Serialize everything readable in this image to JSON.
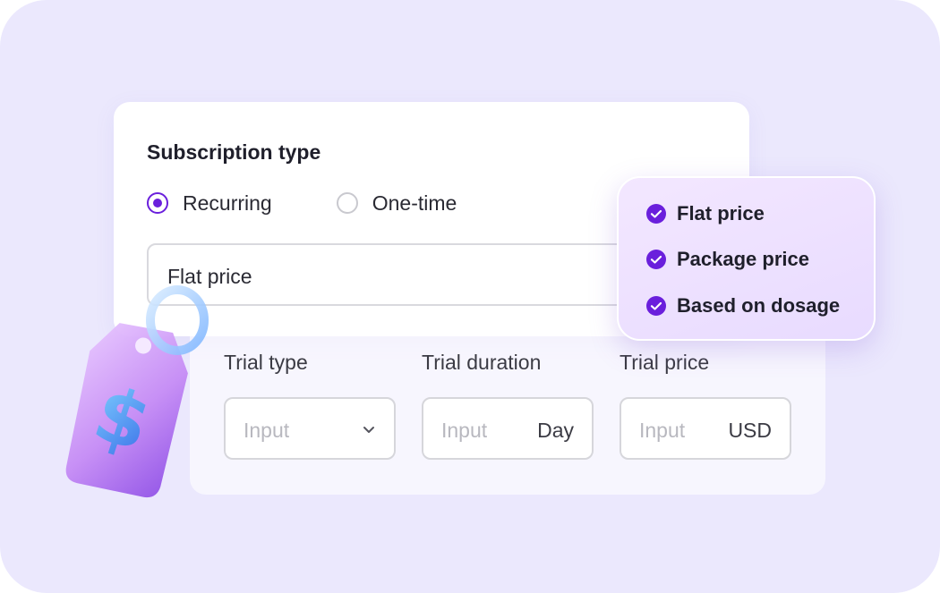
{
  "subscription": {
    "title": "Subscription type",
    "options": [
      {
        "label": "Recurring",
        "checked": true
      },
      {
        "label": "One-time",
        "checked": false
      }
    ],
    "price_select_value": "Flat price"
  },
  "trial": {
    "type_label": "Trial type",
    "type_placeholder": "Input",
    "duration_label": "Trial duration",
    "duration_placeholder": "Input",
    "duration_unit": "Day",
    "price_label": "Trial price",
    "price_placeholder": "Input",
    "price_unit": "USD"
  },
  "price_options": [
    {
      "label": "Flat price",
      "selected": true
    },
    {
      "label": "Package price",
      "selected": true
    },
    {
      "label": "Based on dosage",
      "selected": true
    }
  ],
  "colors": {
    "accent": "#6a1fdc",
    "background": "#ebe8fd",
    "option_card": "#efe3ff"
  },
  "illustration": {
    "icon": "price-tag-dollar-icon",
    "symbol": "$"
  }
}
